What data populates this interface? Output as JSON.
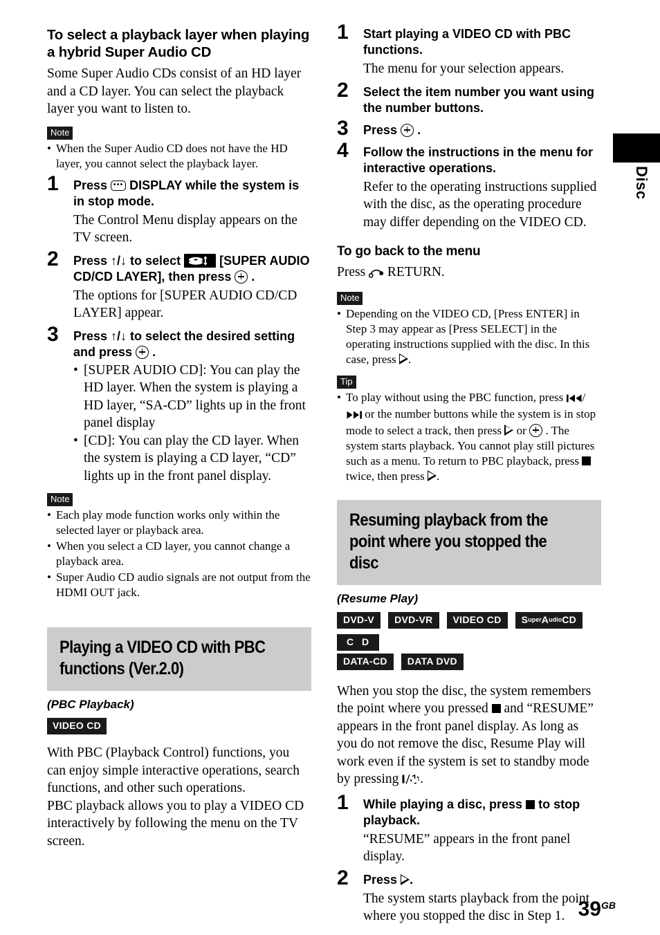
{
  "page": {
    "number": "39",
    "region_code": "GB",
    "side_tab_label": "Disc"
  },
  "left_column": {
    "heading": "To select a playback layer when playing a hybrid Super Audio CD",
    "intro": "Some Super Audio CDs consist of an HD layer and a CD layer. You can select the playback layer you want to listen to.",
    "note_label": "Note",
    "notes_top": [
      "When the Super Audio CD does not have the HD layer, you cannot select the playback layer."
    ],
    "steps": [
      {
        "num": "1",
        "title_before": "Press",
        "title_after": "DISPLAY while the system is in stop mode.",
        "body": "The Control Menu display appears on the TV screen."
      },
      {
        "num": "2",
        "title_part1": "Press ↑/↓ to select",
        "title_part2": "[SUPER AUDIO CD/CD LAYER], then press",
        "title_part3": ".",
        "body": "The options for [SUPER AUDIO CD/CD LAYER] appear."
      },
      {
        "num": "3",
        "title_part1": "Press ↑/↓ to select the desired setting and press",
        "title_part3": ".",
        "bullets": [
          "[SUPER AUDIO CD]: You can play the HD layer. When the system is playing a HD layer, “SA-CD” lights up in the front panel display",
          "[CD]: You can play the CD layer. When the system is playing a CD layer, “CD” lights up in the front panel display."
        ]
      }
    ],
    "notes_bottom": [
      "Each play mode function works only within the selected layer or playback area.",
      "When you select a CD layer, you cannot change a playback area.",
      "Super Audio CD audio signals are not output from the HDMI OUT jack."
    ],
    "section": {
      "band_title": "Playing a VIDEO CD with PBC functions (Ver.2.0)",
      "subtitle": "(PBC Playback)",
      "badge": "VIDEO CD",
      "body": "With PBC (Playback Control) functions, you can enjoy simple interactive operations, search functions, and other such operations.\nPBC playback allows you to play a VIDEO CD interactively by following the menu on the TV screen."
    }
  },
  "right_column": {
    "steps": [
      {
        "num": "1",
        "title": "Start playing a VIDEO CD with PBC functions.",
        "body": "The menu for your selection appears."
      },
      {
        "num": "2",
        "title": "Select the item number you want using the number buttons."
      },
      {
        "num": "3",
        "title_before": "Press",
        "title_after": "."
      },
      {
        "num": "4",
        "title": "Follow the instructions in the menu for interactive operations.",
        "body": "Refer to the operating instructions supplied with the disc, as the operating procedure may differ depending on the VIDEO CD."
      }
    ],
    "back_heading": "To go back to the menu",
    "back_text_before": "Press",
    "back_text_after": "RETURN.",
    "note_label": "Note",
    "note_text_a": "Depending on the VIDEO CD, [Press ENTER] in Step 3 may appear as [Press SELECT] in the operating instructions supplied with the disc. In this case, press",
    "note_text_b": ".",
    "tip_label": "Tip",
    "tip_a": "To play without using the PBC function, press",
    "tip_b": "/",
    "tip_c": "or the number buttons while the system is in stop mode to select a track, then press",
    "tip_d": "or",
    "tip_e": ". The system starts playback. You cannot play still pictures such as a menu. To return to PBC playback, press",
    "tip_f": "twice, then press",
    "tip_g": ".",
    "section": {
      "band_title": "Resuming playback from the point where you stopped the disc",
      "subtitle": "(Resume Play)",
      "badges": [
        {
          "label": "DVD-V",
          "style": "plain"
        },
        {
          "label": "DVD-VR",
          "style": "plain"
        },
        {
          "label": "VIDEO CD",
          "style": "plain"
        },
        {
          "label": "Super Audio CD",
          "style": "superaudio"
        },
        {
          "label": "C D",
          "style": "wide"
        },
        {
          "label": "DATA-CD",
          "style": "plain"
        },
        {
          "label": "DATA DVD",
          "style": "plain"
        }
      ],
      "body_a": "When you stop the disc, the system remembers the point where you pressed",
      "body_b": "and “RESUME” appears in the front panel display. As long as you do not remove the disc, Resume Play will work even if the system is set to standby mode by pressing",
      "body_c": ".",
      "steps": [
        {
          "num": "1",
          "title_before": "While playing a disc, press",
          "title_after": "to stop playback.",
          "body": "“RESUME” appears in the front panel display."
        },
        {
          "num": "2",
          "title_before": "Press",
          "title_after": ".",
          "body": "The system starts playback from the point where you stopped the disc in Step 1."
        }
      ]
    }
  }
}
